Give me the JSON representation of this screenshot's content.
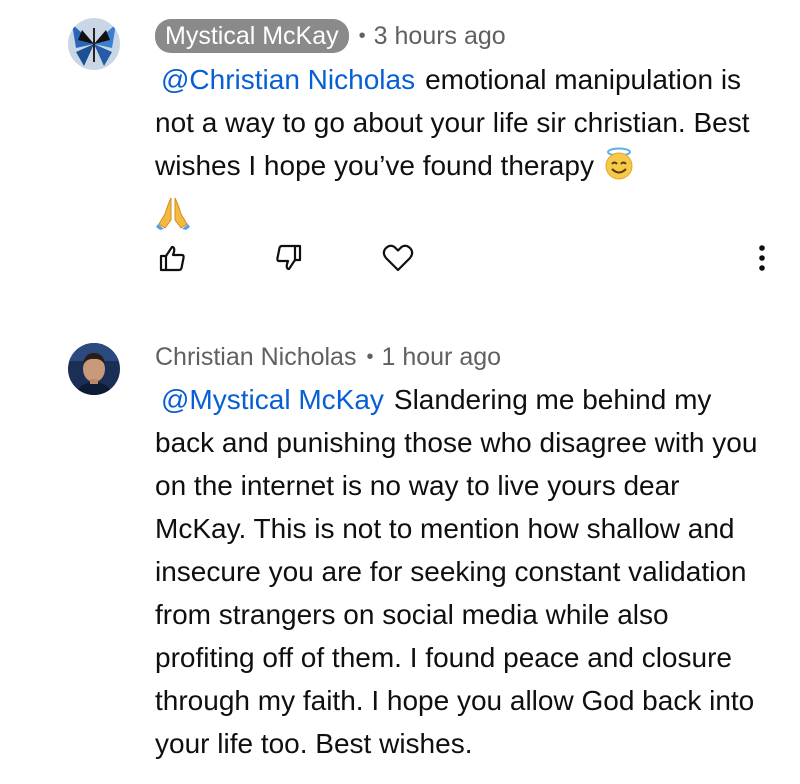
{
  "comments": [
    {
      "author": "Mystical McKay",
      "time": "3 hours ago",
      "separator": "•",
      "mention": "@Christian Nicholas",
      "text_line1_rest": "emotional manipulation",
      "text_rest": "is not a way to go about your life sir christian. Best wishes I hope you’ve found therapy",
      "emojis": [
        "smiling-face-with-halo-emoji",
        "folded-hands-emoji"
      ]
    },
    {
      "author": "Christian Nicholas",
      "time": "1 hour ago",
      "separator": "•",
      "mention": "@Mystical McKay",
      "text": "Slandering me behind my back and punishing those who disagree with you on the internet is no way to live yours dear McKay. This is not to mention how shallow and insecure you are for seeking constant validation from strangers on social media while also profiting off of them. I found peace and closure through my faith. I hope you allow God back into your life too. Best wishes."
    }
  ],
  "actions": {
    "icons": [
      "thumbs-up-icon",
      "thumbs-down-icon",
      "heart-icon",
      "more-vert-icon"
    ]
  },
  "colors": {
    "mention": "#065fd4",
    "meta": "#606060",
    "chip_bg": "#8a8a8a",
    "text": "#0f0f0f"
  }
}
